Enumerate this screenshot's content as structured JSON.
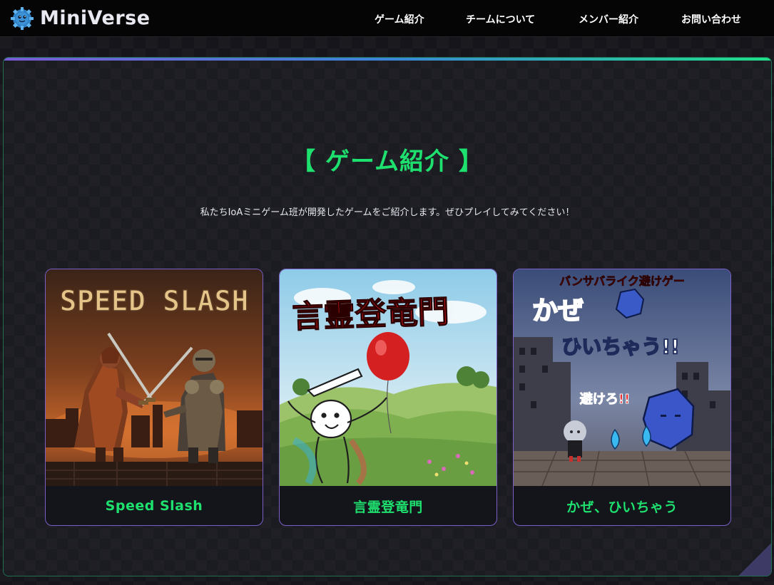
{
  "header": {
    "logo_text": "MiniVerse",
    "logo_icon": "blue-gear-creature-icon",
    "nav": [
      {
        "label": "ゲーム紹介"
      },
      {
        "label": "チームについて"
      },
      {
        "label": "メンバー紹介"
      },
      {
        "label": "お問い合わせ"
      }
    ]
  },
  "section": {
    "title": "【 ゲーム紹介 】",
    "description": "私たちIoAミニゲーム班が開発したゲームをご紹介します。ぜひプレイしてみてください！"
  },
  "games": [
    {
      "title": "Speed Slash",
      "image_text": [
        "SPEED SLASH"
      ]
    },
    {
      "title": "言霊登竜門",
      "image_text": [
        "言霊登竜門"
      ]
    },
    {
      "title": "かぜ、ひいちゃう",
      "image_text": [
        "バンサバライク避けゲー",
        "かぜ",
        "ひいちゃう!!",
        "避けろ!!"
      ]
    }
  ],
  "colors": {
    "accent_green": "#1ee06e",
    "card_border": "#7b5fc9",
    "header_bg": "#050506",
    "panel_bg": "#1b1b22"
  }
}
